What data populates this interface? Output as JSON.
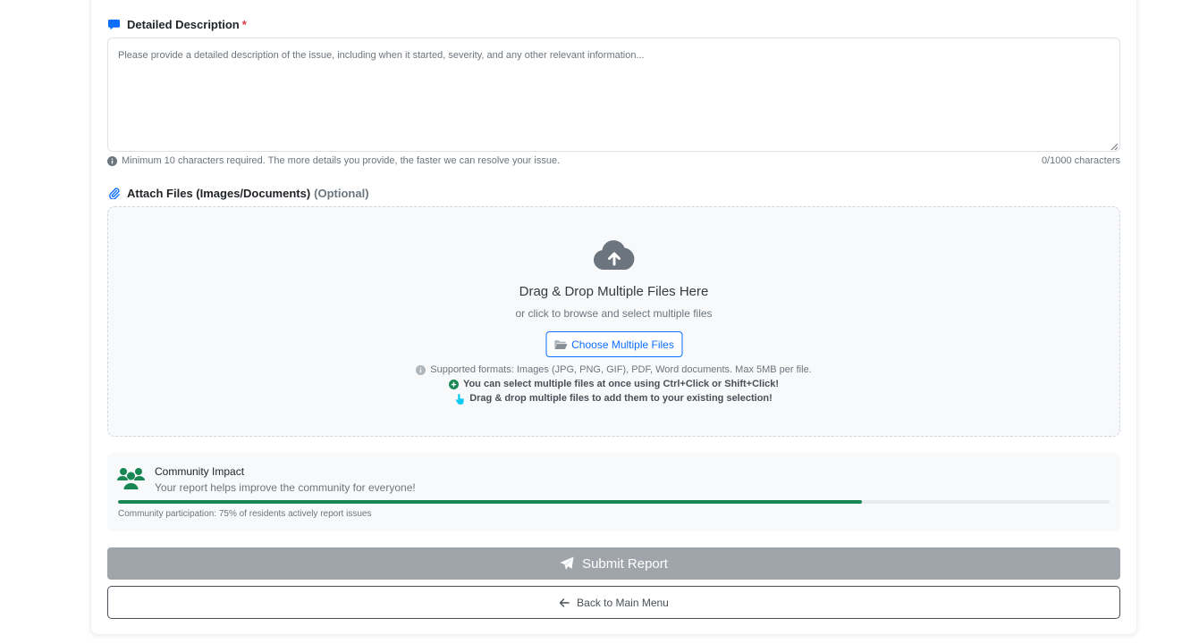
{
  "description": {
    "label": "Detailed Description",
    "required_mark": "*",
    "placeholder": "Please provide a detailed description of the issue, including when it started, severity, and any other relevant information...",
    "hint": "Minimum 10 characters required. The more details you provide, the faster we can resolve your issue.",
    "counter": "0/1000 characters",
    "icon": "comment-icon"
  },
  "attachments": {
    "label": "Attach Files (Images/Documents)",
    "optional": "(Optional)",
    "icon": "paperclip-icon",
    "dropzone_title": "Drag & Drop Multiple Files Here",
    "dropzone_sub": "or click to browse and select multiple files",
    "choose_button": "Choose Multiple Files",
    "formats": "Supported formats: Images (JPG, PNG, GIF), PDF, Word documents. Max 5MB per file.",
    "tip_multi_select": "You can select multiple files at once using Ctrl+Click or Shift+Click!",
    "tip_drag": "Drag & drop multiple files to add them to your existing selection!"
  },
  "community": {
    "title": "Community Impact",
    "subtitle": "Your report helps improve the community for everyone!",
    "progress_percent": 75,
    "footnote": "Community participation: 75% of residents actively report issues"
  },
  "actions": {
    "submit": "Submit Report",
    "back": "Back to Main Menu"
  },
  "colors": {
    "primary": "#0d6efd",
    "success": "#198754",
    "danger": "#dc3545",
    "submit_disabled": "#a0a5ab",
    "info": "#0dcaf0"
  }
}
